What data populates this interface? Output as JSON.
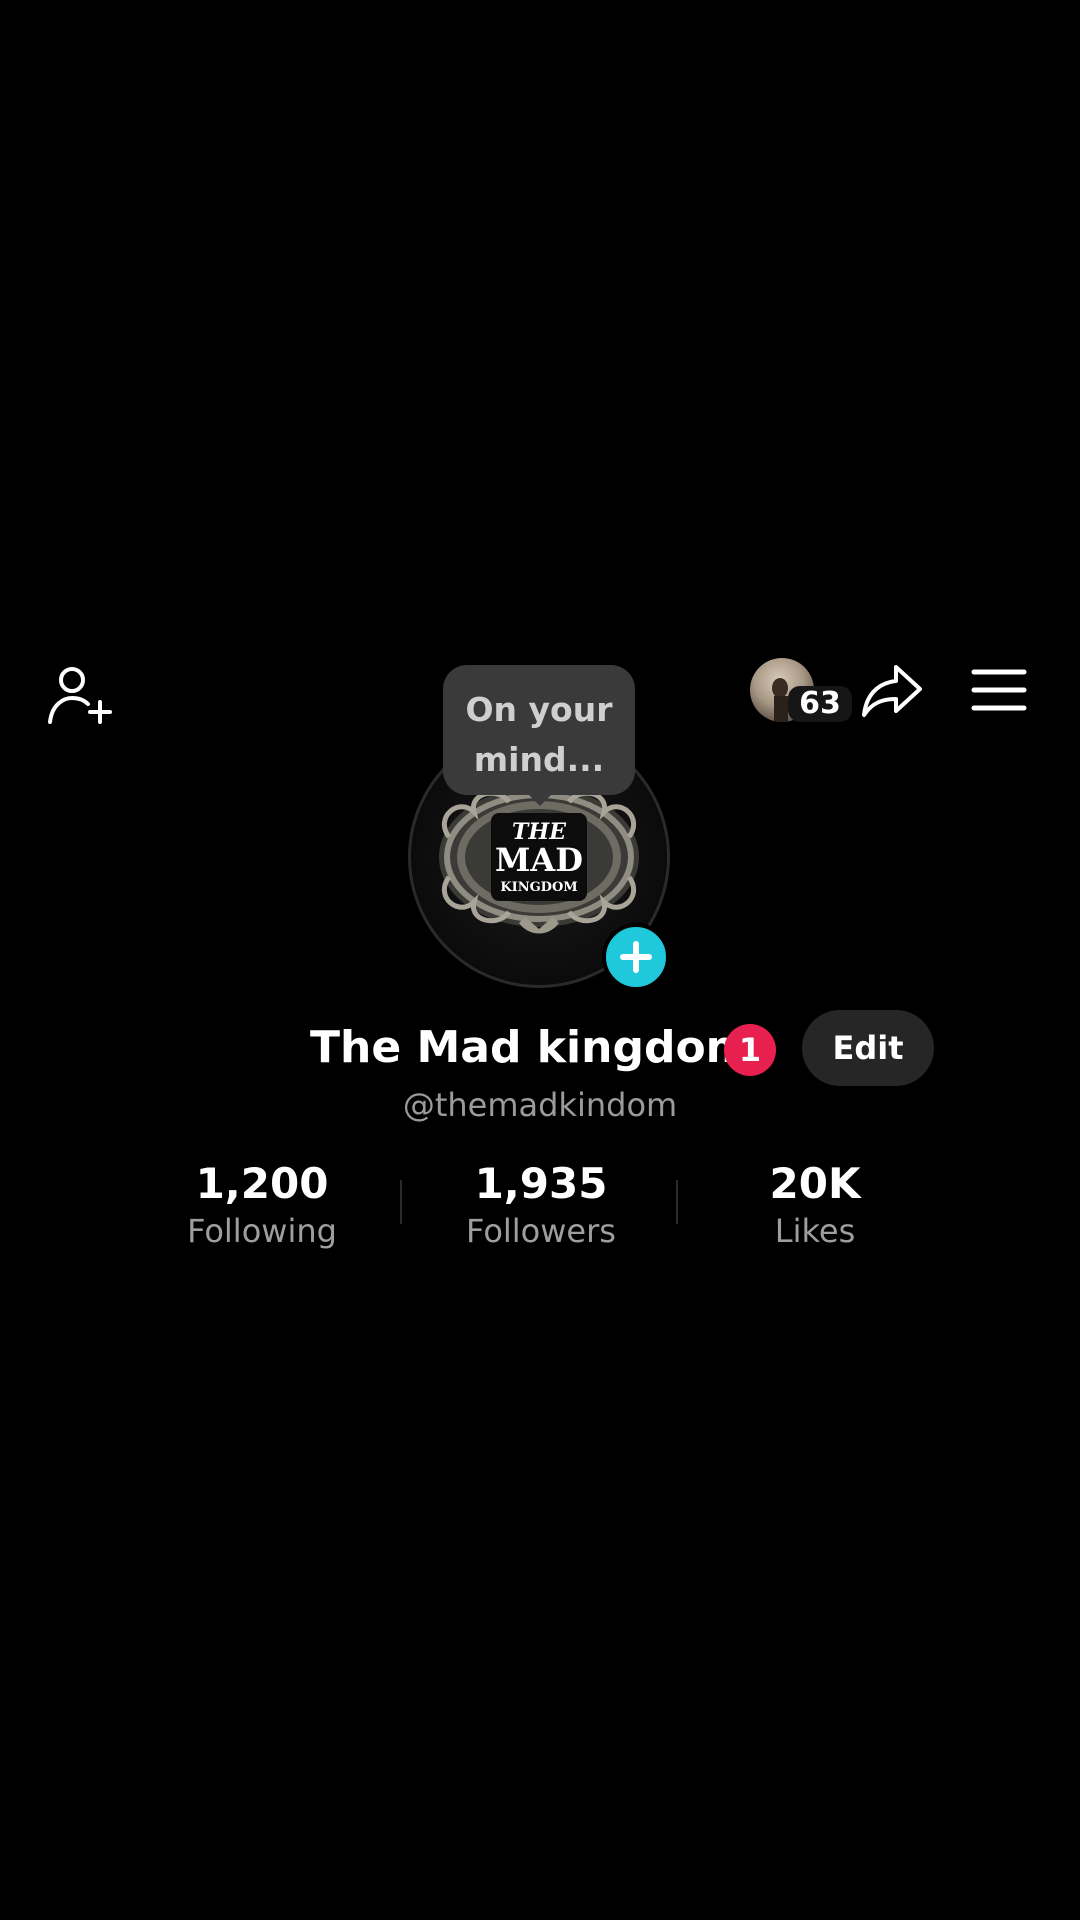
{
  "header": {
    "add_friend_icon": "add-person-icon",
    "visitors": {
      "count": "63"
    },
    "share_icon": "share-arrow-icon",
    "menu_icon": "hamburger-menu-icon"
  },
  "note_bubble": {
    "line1": "On your",
    "line2": "mind..."
  },
  "avatar": {
    "logo_text": [
      "THE",
      "MAD",
      "KINGDOM"
    ],
    "add_story_icon": "plus-icon",
    "add_story_color": "#1fc8db"
  },
  "profile": {
    "display_name": "The Mad kingdom",
    "badge_count": "1",
    "badge_color": "#e8204f",
    "edit_label": "Edit",
    "username": "@themadkindom"
  },
  "stats": [
    {
      "value": "1,200",
      "label": "Following"
    },
    {
      "value": "1,935",
      "label": "Followers"
    },
    {
      "value": "20K",
      "label": "Likes"
    }
  ]
}
